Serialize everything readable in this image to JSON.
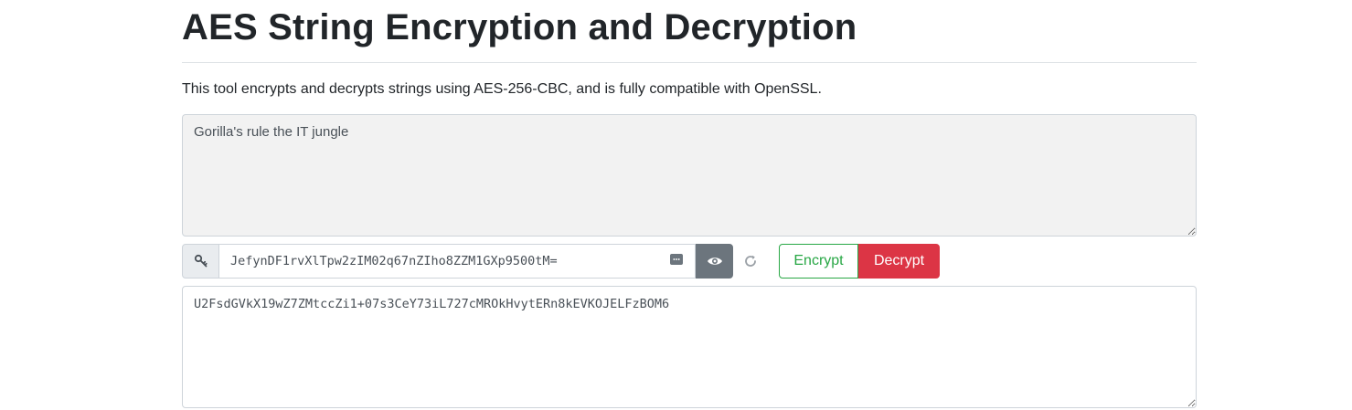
{
  "page": {
    "title": "AES String Encryption and Decryption",
    "intro": "This tool encrypts and decrypts strings using AES-256-CBC, and is fully compatible with OpenSSL."
  },
  "plaintext": {
    "value": "Gorilla's rule the IT jungle"
  },
  "key": {
    "icon": "key-icon",
    "value": "JefynDF1rvXlTpw2zIM02q67nZIho8ZZM1GXp9500tM=",
    "show_icon": "eye-icon",
    "regenerate_icon": "refresh-icon",
    "password_manager_icon": "password-manager-icon"
  },
  "actions": {
    "encrypt_label": "Encrypt",
    "decrypt_label": "Decrypt"
  },
  "ciphertext": {
    "value": "U2FsdGVkX19wZ7ZMtccZi1+07s3CeY73iL727cMROkHvytERn8kEVKOJELFzBOM6"
  },
  "colors": {
    "encrypt": "#28a745",
    "decrypt": "#dc3545",
    "secondary": "#6c757d",
    "plaintext_bg": "#f2f2f2"
  }
}
